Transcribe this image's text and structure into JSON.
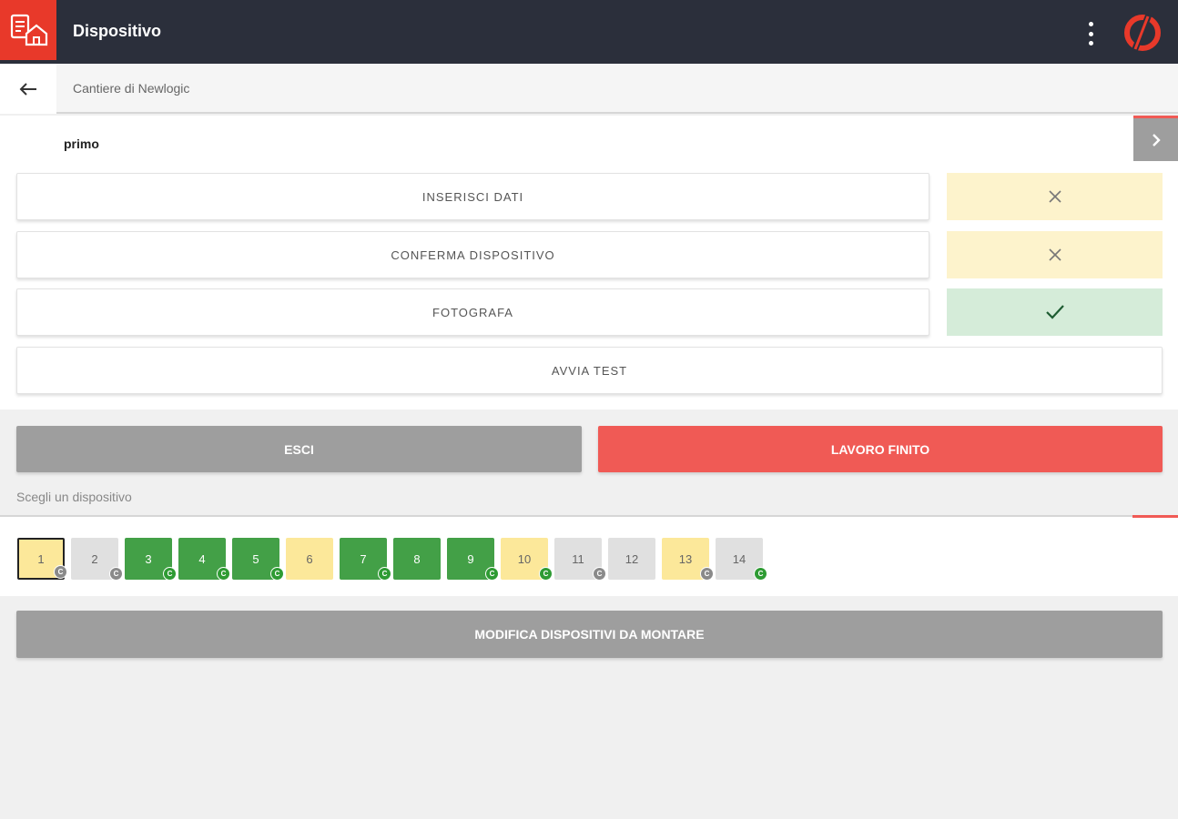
{
  "header": {
    "title": "Dispositivo",
    "app_icon": "house-document-icon",
    "menu_icon": "more-vertical-icon",
    "brand_icon": "brand-logo-icon"
  },
  "subheader": {
    "back_icon": "arrow-left-icon",
    "breadcrumb": "Cantiere di Newlogic"
  },
  "device": {
    "name": "primo",
    "next_icon": "chevron-right-icon"
  },
  "actions": [
    {
      "label": "INSERISCI DATI",
      "status": "incomplete",
      "status_icon": "close-icon"
    },
    {
      "label": "CONFERMA DISPOSITIVO",
      "status": "incomplete",
      "status_icon": "close-icon"
    },
    {
      "label": "FOTOGRAFA",
      "status": "complete",
      "status_icon": "check-icon"
    },
    {
      "label": "AVVIA TEST"
    }
  ],
  "buttons": {
    "exit": "ESCI",
    "finish": "LAVORO FINITO",
    "modify": "MODIFICA DISPOSITIVI DA MONTARE"
  },
  "choose_label": "Scegli un dispositivo",
  "devices": [
    {
      "number": "1",
      "state": "yellow",
      "selected": true,
      "badge": "grey"
    },
    {
      "number": "2",
      "state": "grey",
      "badge": "grey"
    },
    {
      "number": "3",
      "state": "green",
      "badge": "green"
    },
    {
      "number": "4",
      "state": "green",
      "badge": "green"
    },
    {
      "number": "5",
      "state": "green",
      "badge": "green"
    },
    {
      "number": "6",
      "state": "yellow"
    },
    {
      "number": "7",
      "state": "green",
      "badge": "green"
    },
    {
      "number": "8",
      "state": "green"
    },
    {
      "number": "9",
      "state": "green",
      "badge": "green"
    },
    {
      "number": "10",
      "state": "yellow",
      "badge": "green"
    },
    {
      "number": "11",
      "state": "grey",
      "badge": "grey"
    },
    {
      "number": "12",
      "state": "grey"
    },
    {
      "number": "13",
      "state": "yellow",
      "badge": "grey"
    },
    {
      "number": "14",
      "state": "grey",
      "badge": "green"
    }
  ],
  "badge_letter": "C",
  "colors": {
    "topbar": "#2b2f3b",
    "accent_red": "#e8392a",
    "finish_red": "#f05a55",
    "grey_button": "#9e9e9e",
    "tile_green": "#43a047",
    "tile_yellow": "#fce89a",
    "tile_grey": "#e0e0e0",
    "status_no": "#fdf3cc",
    "status_yes": "#d5ecd9",
    "badge_green": "#2e9b33",
    "badge_grey": "#8a8a8a"
  }
}
